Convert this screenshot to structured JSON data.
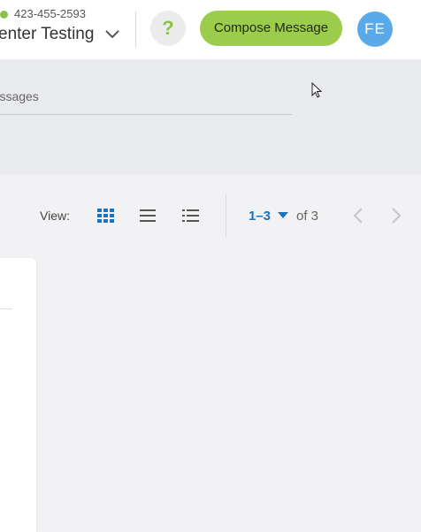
{
  "header": {
    "phone": "423-455-2593",
    "account_name": "enter Testing",
    "help_label": "?",
    "compose_label": "Compose Message",
    "avatar_initials": "FE",
    "status_color": "#8bc34a",
    "compose_color": "#9ccc4c",
    "avatar_color": "#5aa9e8"
  },
  "search": {
    "placeholder": "Messages",
    "value": ""
  },
  "toolbar": {
    "view_label": "View:",
    "view_modes": [
      "grid-icon",
      "list-icon",
      "detailed-list-icon"
    ],
    "active_view": "grid",
    "accent_color": "#1f72b8"
  },
  "pager": {
    "range": "1–3",
    "of_label": "of 3"
  }
}
